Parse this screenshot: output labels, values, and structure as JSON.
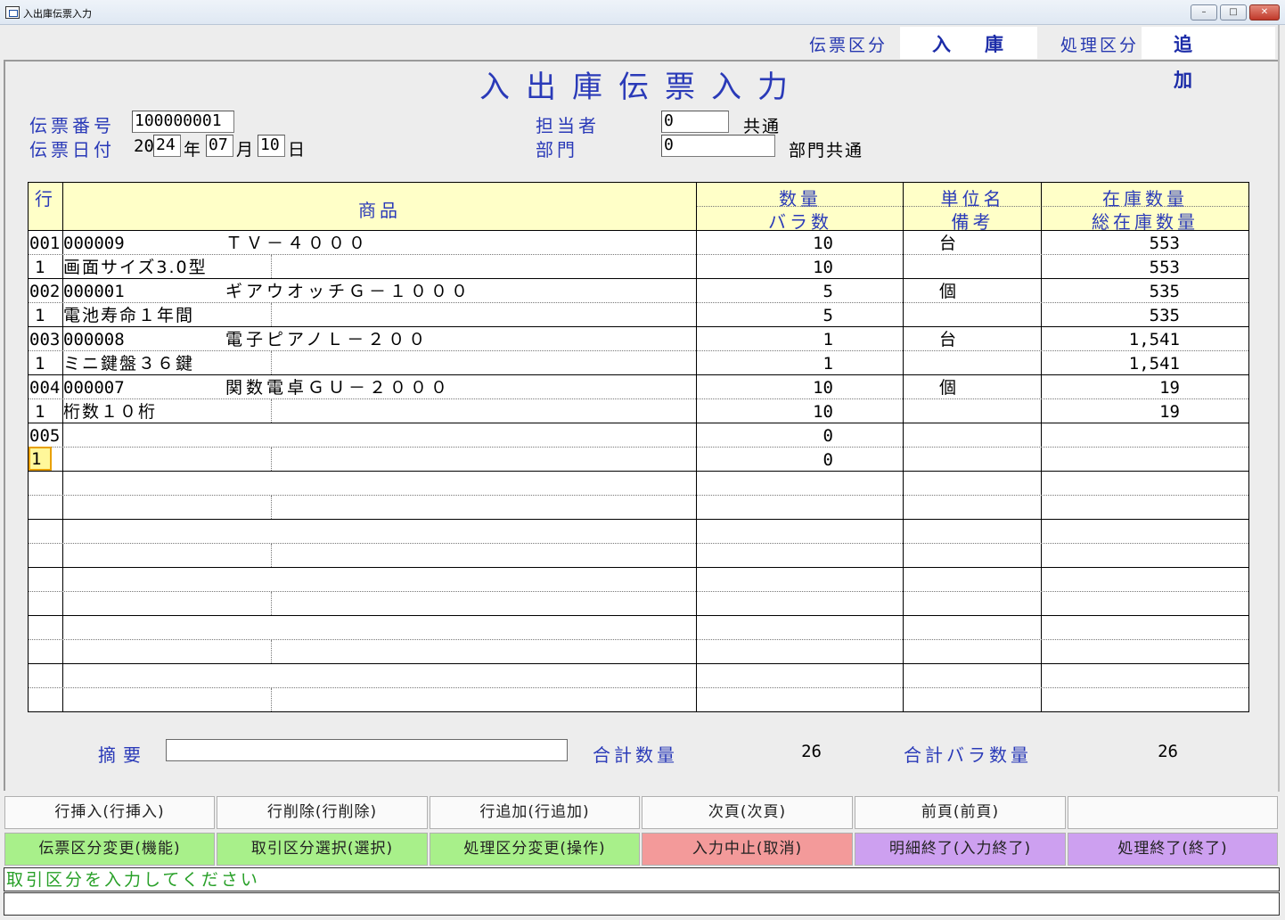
{
  "window": {
    "title": "入出庫伝票入力",
    "min": "–",
    "max": "□",
    "close": "✕"
  },
  "header": {
    "slip_type_label": "伝票区分",
    "slip_type_value": "入庫",
    "process_type_label": "処理区分",
    "process_type_value": "追加"
  },
  "form_title": "入出庫伝票入力",
  "fields": {
    "slip_no_label": "伝票番号",
    "slip_no": "100000001",
    "slip_date_label": "伝票日付",
    "year_prefix": "20",
    "year": "24",
    "year_label": "年",
    "month": "07",
    "month_label": "月",
    "day": "10",
    "day_label": "日",
    "staff_label": "担当者",
    "staff_code": "0",
    "staff_name": "共通",
    "dept_label": "部門",
    "dept_code": "0",
    "dept_name": "部門共通"
  },
  "grid": {
    "headers": {
      "row": "行",
      "product": "商品",
      "qty": "数量",
      "loose_qty": "バラ数",
      "unit": "単位名",
      "remarks": "備考",
      "stock": "在庫数量",
      "total_stock": "総在庫数量"
    },
    "rows": [
      {
        "line": "001",
        "sub": "1",
        "code": "000009",
        "name": "ＴＶ－４０００",
        "note": "画面サイズ3.0型",
        "qty": "10",
        "loose": "10",
        "unit": "台",
        "stock": "553",
        "total": "553"
      },
      {
        "line": "002",
        "sub": "1",
        "code": "000001",
        "name": "ギアウオッチＧ－１０００",
        "note": "電池寿命１年間",
        "qty": "5",
        "loose": "5",
        "unit": "個",
        "stock": "535",
        "total": "535"
      },
      {
        "line": "003",
        "sub": "1",
        "code": "000008",
        "name": "電子ピアノＬ－２００",
        "note": "ミニ鍵盤３６鍵",
        "qty": "1",
        "loose": "1",
        "unit": "台",
        "stock": "1,541",
        "total": "1,541"
      },
      {
        "line": "004",
        "sub": "1",
        "code": "000007",
        "name": "関数電卓ＧＵ－２０００",
        "note": "桁数１０桁",
        "qty": "10",
        "loose": "10",
        "unit": "個",
        "stock": "19",
        "total": "19"
      },
      {
        "line": "005",
        "sub": "1",
        "code": "",
        "name": "",
        "note": "",
        "qty": "0",
        "loose": "0",
        "unit": "",
        "stock": "",
        "total": ""
      }
    ]
  },
  "footer": {
    "summary_label": "摘要",
    "summary_value": "",
    "total_qty_label": "合計数量",
    "total_qty": "26",
    "total_loose_label": "合計バラ数量",
    "total_loose": "26"
  },
  "buttons_row1": [
    "行挿入(行挿入)",
    "行削除(行削除)",
    "行追加(行追加)",
    "次頁(次頁)",
    "前頁(前頁)",
    ""
  ],
  "buttons_row2": [
    "伝票区分変更(機能)",
    "取引区分選択(選択)",
    "処理区分変更(操作)",
    "入力中止(取消)",
    "明細終了(入力終了)",
    "処理終了(終了)"
  ],
  "button_colors": {
    "green": "#a8f08a",
    "red": "#f39a9a",
    "purple": "#cda0f0"
  },
  "status_message": "取引区分を入力してください"
}
